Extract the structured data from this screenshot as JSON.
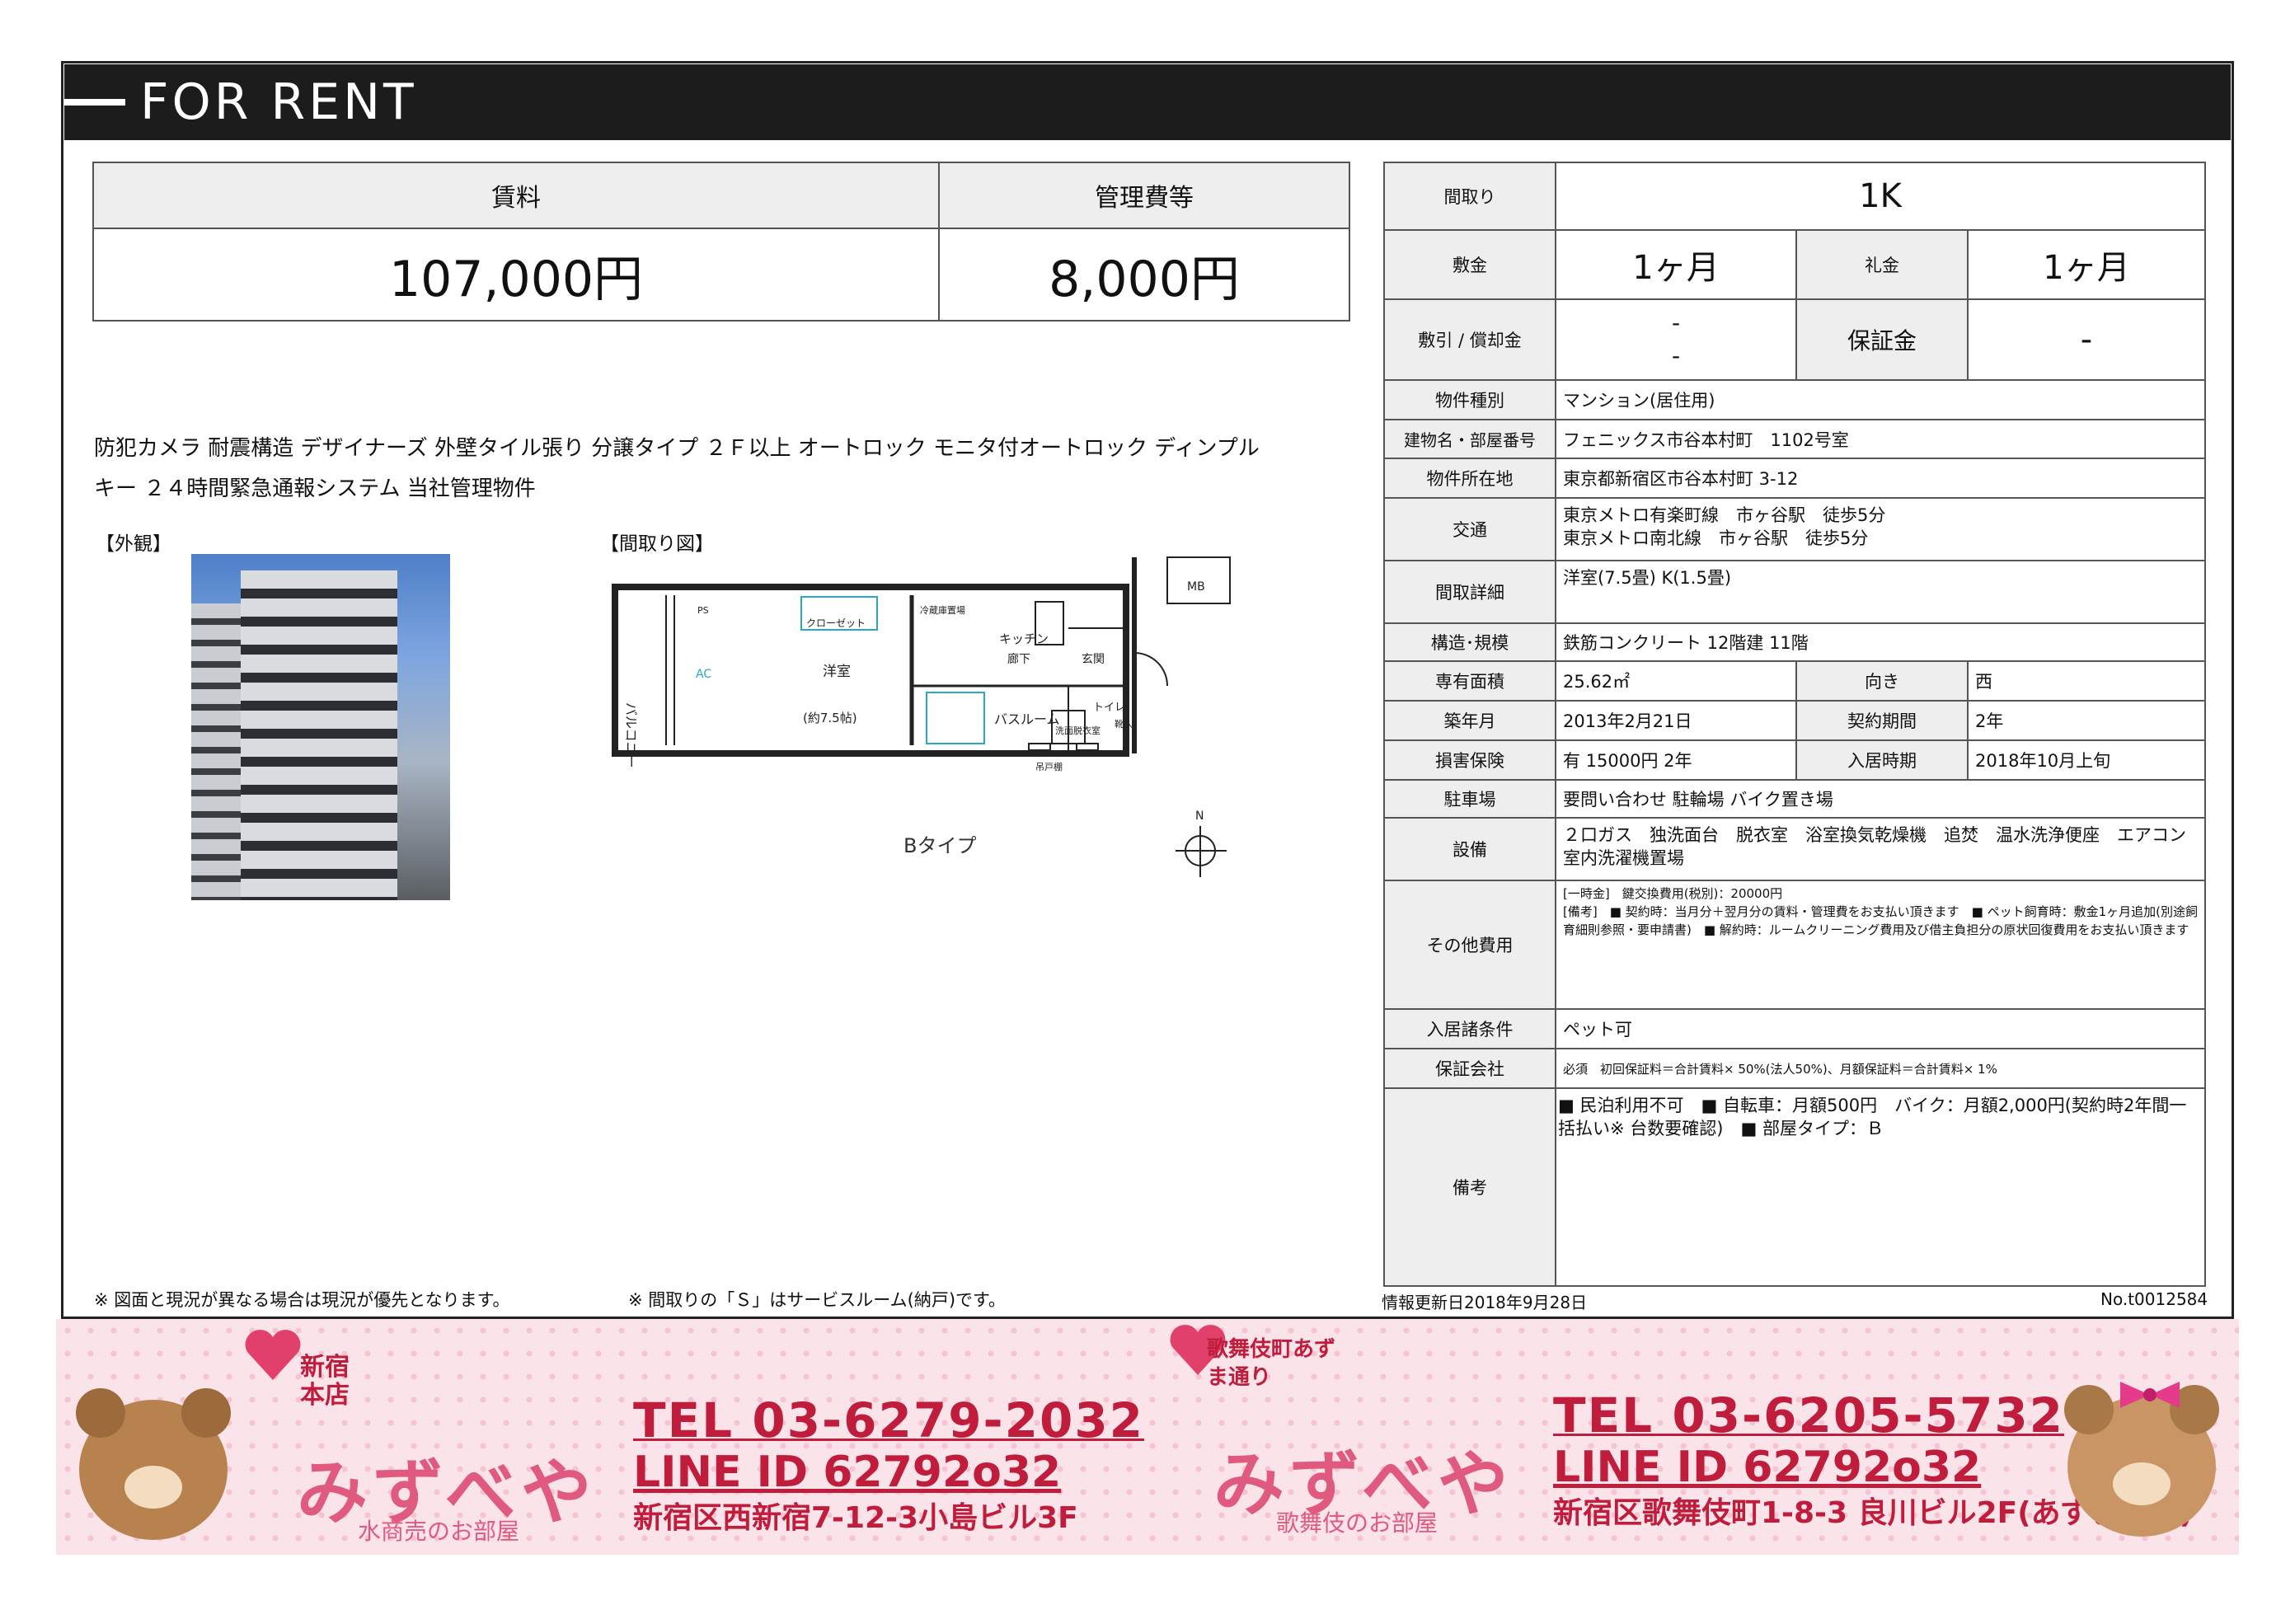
{
  "header": {
    "title": "FOR RENT"
  },
  "rent": {
    "rent_label": "賃料",
    "fee_label": "管理費等",
    "rent_value": "107,000円",
    "fee_value": "8,000円"
  },
  "features_line1": "防犯カメラ 耐震構造 デザイナーズ 外壁タイル張り 分譲タイプ ２Ｆ以上 オートロック モニタ付オートロック ディンプル",
  "features_line2": "キー ２４時間緊急通報システム 当社管理物件",
  "sections": {
    "exterior": "【外観】",
    "floorplan": "【間取り図】"
  },
  "floorplan": {
    "type": "Bタイプ",
    "labels": {
      "balcony": "バルコニー",
      "ac": "AC",
      "room": "洋室",
      "room_size": "(約7.5帖)",
      "closet": "クローゼット",
      "fridge": "冷蔵庫置場",
      "kitchen": "キッチン",
      "hall": "廊下",
      "entrance": "玄関",
      "bath": "バスルーム",
      "washroom": "洗面脱衣室",
      "toilet": "トイレ",
      "mb": "MB",
      "ps": "PS",
      "shoes": "靴入",
      "fusuma": "吊戸棚",
      "north": "N"
    }
  },
  "notes": {
    "left": "※ 図面と現況が異なる場合は現況が優先となります。",
    "right": "※ 間取りの「Ｓ」はサービスルーム(納戸)です。"
  },
  "info": {
    "layout_k": "間取り",
    "layout_v": "1K",
    "deposit_k": "敷金",
    "deposit_v": "1ヶ月",
    "key_k": "礼金",
    "key_v": "1ヶ月",
    "shiki_k": "敷引 / 償却金",
    "shiki_v1": "-",
    "shiki_v2": "-",
    "guarantee_k": "保証金",
    "guarantee_v": "-",
    "type_k": "物件種別",
    "type_v": "マンション(居住用)",
    "name_k": "建物名・部屋番号",
    "name_v": "フェニックス市谷本村町　1102号室",
    "address_k": "物件所在地",
    "address_v": "東京都新宿区市谷本村町 3-12",
    "transit_k": "交通",
    "transit_v1": "東京メトロ有楽町線　市ヶ谷駅　徒歩5分",
    "transit_v2": "東京メトロ南北線　市ヶ谷駅　徒歩5分",
    "detail_k": "間取詳細",
    "detail_v": "洋室(7.5畳) K(1.5畳)",
    "structure_k": "構造･規模",
    "structure_v": "鉄筋コンクリート 12階建 11階",
    "area_k": "専有面積",
    "area_v": "25.62㎡",
    "dir_k": "向き",
    "dir_v": "西",
    "built_k": "築年月",
    "built_v": "2013年2月21日",
    "term_k": "契約期間",
    "term_v": "2年",
    "insurance_k": "損害保険",
    "insurance_v": "有  15000円 2年",
    "movein_k": "入居時期",
    "movein_v": "2018年10月上旬",
    "parking_k": "駐車場",
    "parking_v": "要問い合わせ 駐輪場 バイク置き場",
    "equip_k": "設備",
    "equip_v": "２口ガス　独洗面台　脱衣室　浴室換気乾燥機　追焚　温水洗浄便座　エアコン　室内洗濯機置場",
    "other_k": "その他費用",
    "other_v1": "[一時金]　鍵交換費用(税別)：20000円",
    "other_v2": "[備考]　■ 契約時：当月分＋翌月分の賃料・管理費をお支払い頂きます　■ ペット飼育時：敷金1ヶ月追加(別途飼育細則参照・要申請書)　■ 解約時：ルームクリーニング費用及び借主負担分の原状回復費用をお支払い頂きます",
    "cond_k": "入居諸条件",
    "cond_v": "ペット可",
    "gcomp_k": "保証会社",
    "gcomp_v": "必須　初回保証料＝合計賃料× 50%(法人50%)、月額保証料＝合計賃料× 1%",
    "remarks_k": "備考",
    "remarks_v": "■ 民泊利用不可　■ 自転車：月額500円　バイク：月額2,000円(契約時2年間一括払い※ 台数要確認)　■ 部屋タイプ：Ｂ"
  },
  "footer": {
    "updated": "情報更新日2018年9月28日",
    "number": "No.t0012584"
  },
  "banner": {
    "shop1": {
      "sign": "新宿本店",
      "logo": "みずべや",
      "sub": "水商売のお部屋",
      "tel": "TEL 03-6279-2032",
      "line": "LINE ID 62792o32",
      "addr": "新宿区西新宿7-12-3小島ビル3F"
    },
    "shop2": {
      "sign": "歌舞伎町あずま通り",
      "logo": "みずべや",
      "sub": "歌舞伎のお部屋",
      "tel": "TEL 03-6205-5732",
      "line": "LINE ID 62792o32",
      "addr": "新宿区歌舞伎町1-8-3 良川ビル2F(あずま通り)"
    }
  },
  "colors": {
    "header_bg": "#1c1c1c",
    "label_bg": "#eeeeee",
    "banner_bg": "#fbe3ea",
    "banner_text": "#c01c3c"
  }
}
